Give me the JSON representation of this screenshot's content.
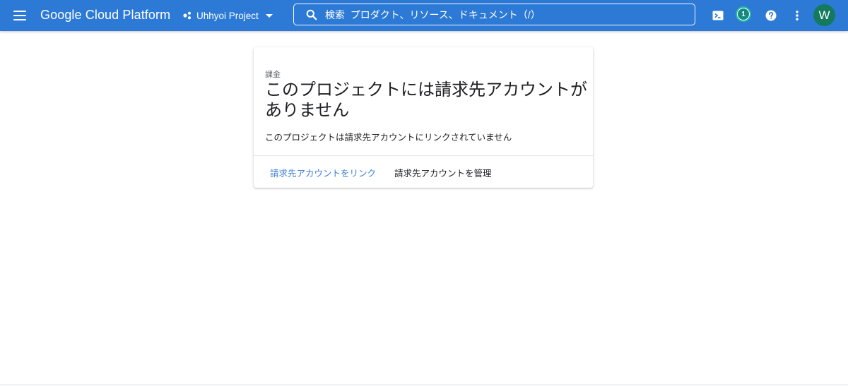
{
  "header": {
    "brand": "Google Cloud Platform",
    "project_name": "Uhhyoi Project",
    "search_placeholder": "検索  プロダクト、リソース、ドキュメント（/）",
    "notification_count": "1",
    "avatar_initial": "W"
  },
  "card": {
    "overline": "課金",
    "title": "このプロジェクトには請求先アカウントがありません",
    "description": "このプロジェクトは請求先アカウントにリンクされていません",
    "link_button": "請求先アカウントをリンク",
    "manage_button": "請求先アカウントを管理"
  },
  "colors": {
    "header_bg": "#2d7ad6",
    "link": "#3f7fd6",
    "badge_ring": "#1fb8a6",
    "avatar_bg": "#137a5d"
  }
}
